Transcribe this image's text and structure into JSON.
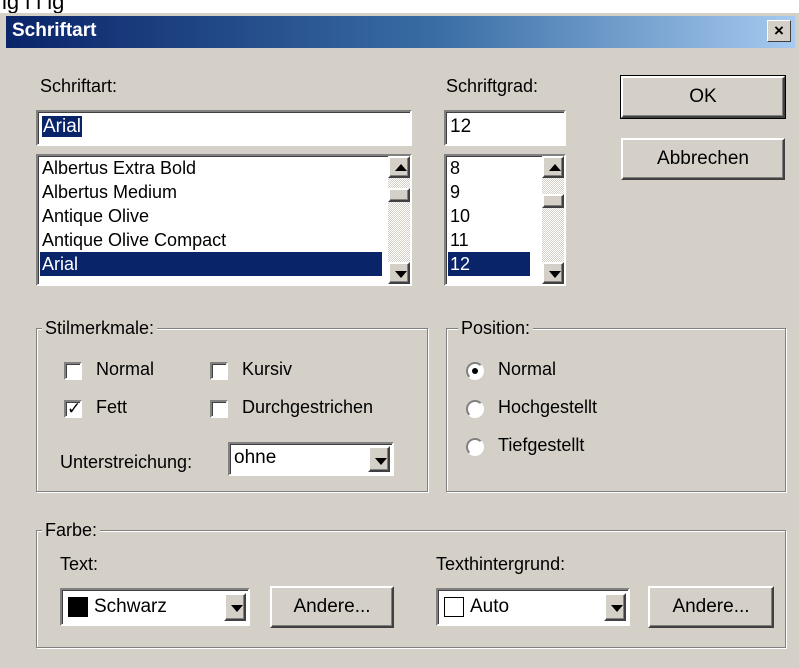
{
  "top_strip_text": "ig l l ig",
  "dialog": {
    "title": "Schriftart",
    "close_glyph": "×"
  },
  "font": {
    "label": "Schriftart:",
    "value": "Arial",
    "list": [
      "Albertus Extra Bold",
      "Albertus Medium",
      "Antique Olive",
      "Antique Olive Compact",
      "Arial"
    ],
    "selected": "Arial"
  },
  "size": {
    "label": "Schriftgrad:",
    "value": "12",
    "list": [
      "8",
      "9",
      "10",
      "11",
      "12"
    ],
    "selected": "12"
  },
  "buttons": {
    "ok": "OK",
    "cancel": "Abbrechen"
  },
  "style": {
    "legend": "Stilmerkmale:",
    "normal": {
      "label": "Normal",
      "checked": false
    },
    "italic": {
      "label": "Kursiv",
      "checked": false
    },
    "bold": {
      "label": "Fett",
      "checked": true
    },
    "strike": {
      "label": "Durchgestrichen",
      "checked": false
    },
    "underline_label": "Unterstreichung:",
    "underline_value": "ohne"
  },
  "position": {
    "legend": "Position:",
    "options": [
      "Normal",
      "Hochgestellt",
      "Tiefgestellt"
    ],
    "selected": "Normal"
  },
  "color": {
    "legend": "Farbe:",
    "text_label": "Text:",
    "text_value": "Schwarz",
    "text_swatch": "#000000",
    "bg_label": "Texthintergrund:",
    "bg_value": "Auto",
    "bg_swatch": "#ffffff",
    "other_button": "Andere..."
  },
  "icons": {
    "checkbox_check": "check-icon",
    "radio_dot": "radio-selected-icon",
    "scroll_up": "arrow-up-icon",
    "scroll_down": "arrow-down-icon",
    "combo_arrow": "chevron-down-icon"
  },
  "colors": {
    "title_start": "#0a246a",
    "title_end": "#a6caf0",
    "face": "#d4d0c8",
    "selection": "#0a246a"
  }
}
